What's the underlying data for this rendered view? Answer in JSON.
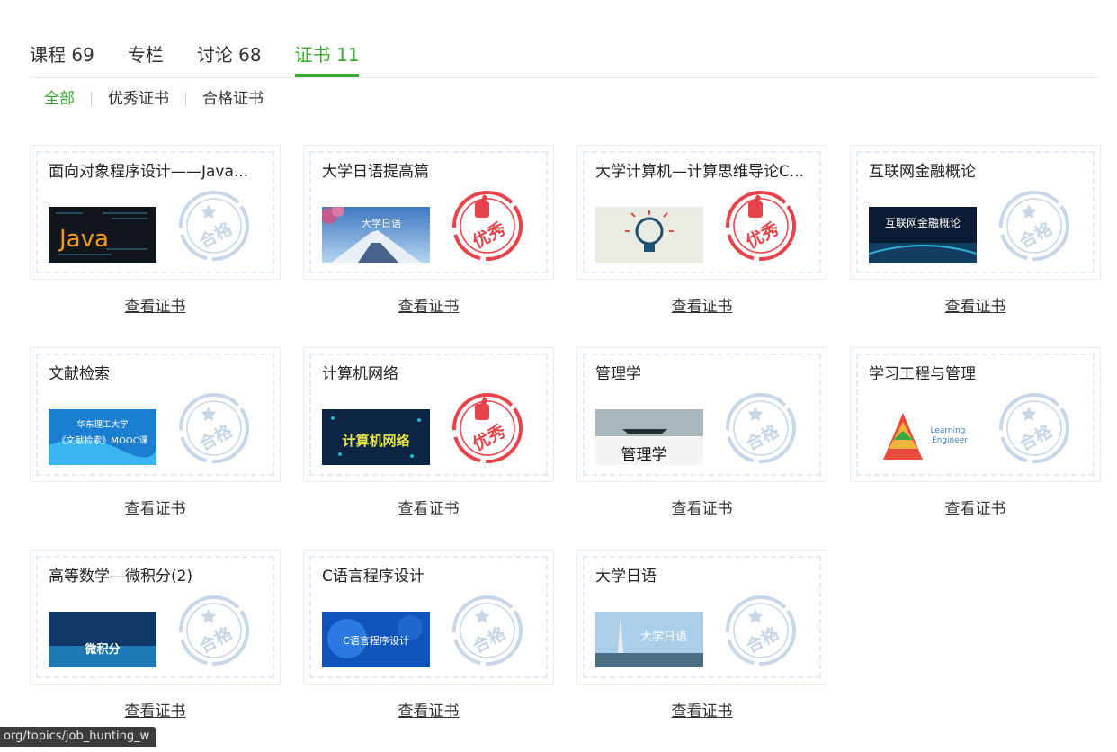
{
  "tabs": [
    {
      "label": "课程 69",
      "active": false
    },
    {
      "label": "专栏",
      "active": false
    },
    {
      "label": "讨论 68",
      "active": false
    },
    {
      "label": "证书 11",
      "active": true
    }
  ],
  "filters": [
    {
      "label": "全部",
      "active": true
    },
    {
      "label": "优秀证书",
      "active": false
    },
    {
      "label": "合格证书",
      "active": false
    }
  ],
  "certificates": [
    {
      "name": "面向对象程序设计——Java...",
      "badge": "合格",
      "thumb": "java",
      "thumb_text": "Java",
      "action": "查看证书"
    },
    {
      "name": "大学日语提高篇",
      "badge": "优秀",
      "thumb": "fuji",
      "thumb_text": "大学日语",
      "action": "查看证书"
    },
    {
      "name": "大学计算机—计算思维导论C...",
      "badge": "优秀",
      "thumb": "brain",
      "thumb_text": "",
      "action": "查看证书"
    },
    {
      "name": "互联网金融概论",
      "badge": "合格",
      "thumb": "fintech",
      "thumb_text": "互联网金融概论",
      "action": "查看证书"
    },
    {
      "name": "文献检索",
      "badge": "合格",
      "thumb": "lit",
      "thumb_text": "华东理工大学 《文献检索》MOOC课",
      "action": "查看证书"
    },
    {
      "name": "计算机网络",
      "badge": "优秀",
      "thumb": "network",
      "thumb_text": "计算机网络",
      "action": "查看证书"
    },
    {
      "name": "管理学",
      "badge": "合格",
      "thumb": "mgmt",
      "thumb_text": "管理学",
      "action": "查看证书"
    },
    {
      "name": "学习工程与管理",
      "badge": "合格",
      "thumb": "pyramid",
      "thumb_text": "Learning Engineer",
      "action": "查看证书"
    },
    {
      "name": "高等数学—微积分(2)",
      "badge": "合格",
      "thumb": "calc",
      "thumb_text": "微积分",
      "action": "查看证书"
    },
    {
      "name": "C语言程序设计",
      "badge": "合格",
      "thumb": "clang",
      "thumb_text": "C语言程序设计",
      "action": "查看证书"
    },
    {
      "name": "大学日语",
      "badge": "合格",
      "thumb": "tower",
      "thumb_text": "大学日语",
      "action": "查看证书"
    }
  ],
  "status_url": "org/topics/job_hunting_w",
  "colors": {
    "accent": "#39a832",
    "excellent_seal": "#e8434a",
    "pass_seal": "#c9d6e6"
  }
}
